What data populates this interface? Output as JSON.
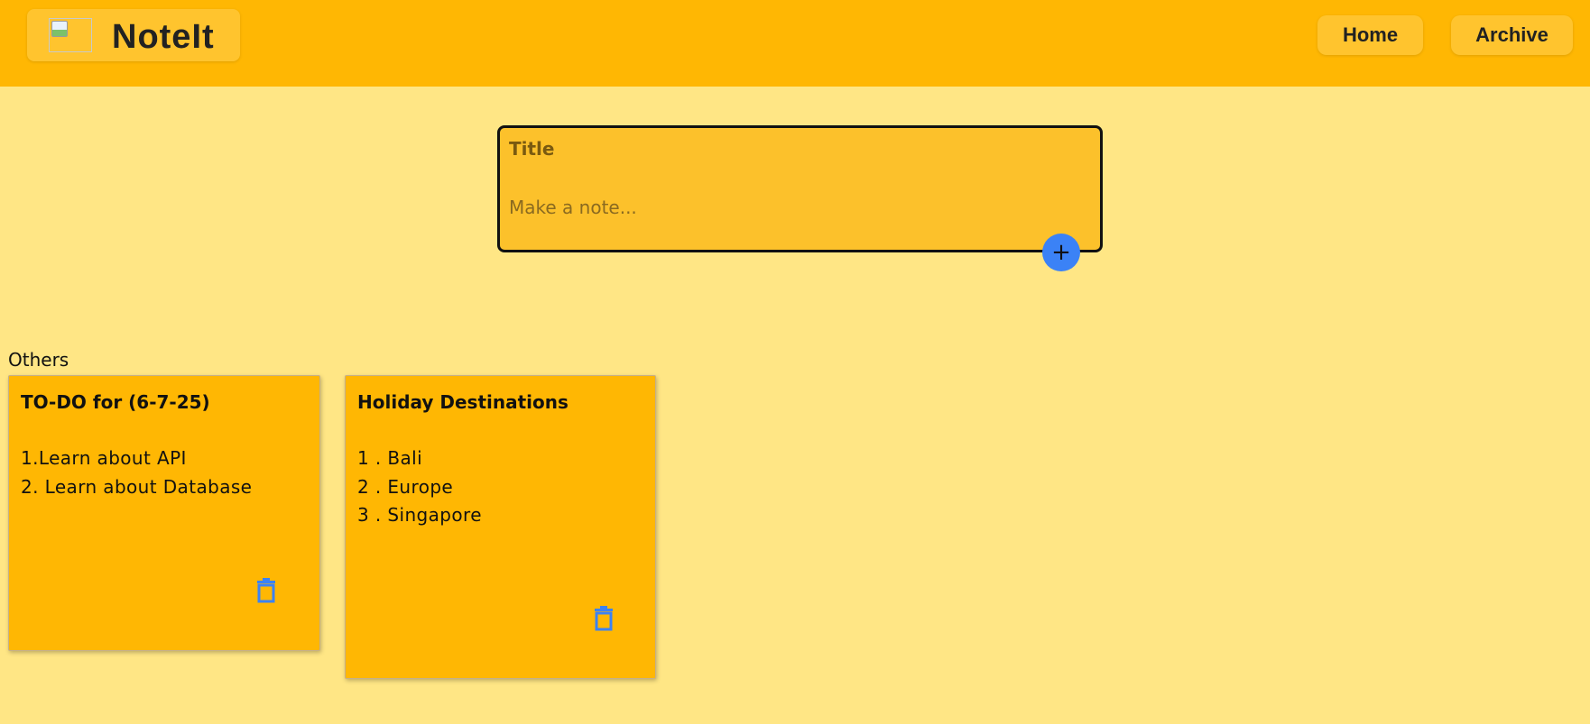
{
  "header": {
    "app_name": "NoteIt",
    "nav": [
      {
        "label": "Home"
      },
      {
        "label": "Archive"
      }
    ]
  },
  "composer": {
    "title_placeholder": "Title",
    "note_placeholder": "Make a note...",
    "add_button_label": "+"
  },
  "notes_section": {
    "label": "Others",
    "notes": [
      {
        "title": "TO-DO for (6-7-25)",
        "lines": [
          "1.Learn about API",
          "2. Learn about Database"
        ]
      },
      {
        "title": "Holiday Destinations",
        "lines": [
          "1 . Bali",
          "2 . Europe",
          "3 . Singapore"
        ]
      }
    ]
  },
  "colors": {
    "page_background": "#FFE685",
    "header_background": "#FFB703",
    "note_card": "#FFB703",
    "accent_blue": "#3B82F6"
  },
  "icons": {
    "logo": "broken-image-icon",
    "delete": "trash-icon",
    "add": "plus-icon"
  }
}
